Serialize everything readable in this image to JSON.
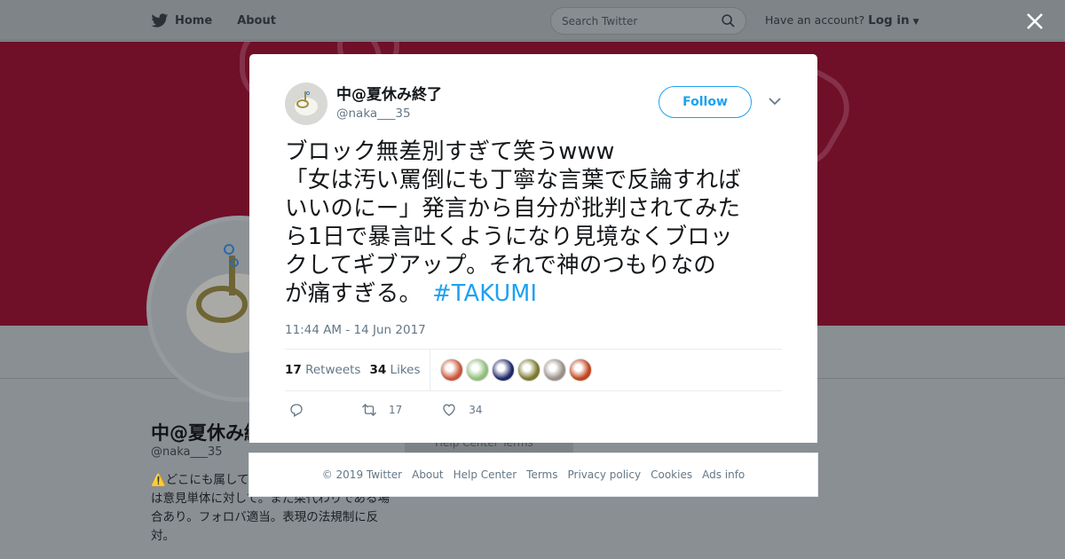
{
  "topbar": {
    "home_label": "Home",
    "about_label": "About",
    "search_placeholder": "Search Twitter",
    "have_account": "Have an account?",
    "login_label": "Log in"
  },
  "profile": {
    "name": "中@夏休み終了",
    "handle": "@naka___35",
    "bio": "⚠️どこにも属して… 基本めんどい。 いいねは意見単体に対して。また栞代わりである場合あり。フォロバ適当。表現の法規制に反対。",
    "footer_peek": "Help Center   Terms"
  },
  "tweet": {
    "author_name": "中@夏休み終了",
    "author_handle": "@naka___35",
    "follow_label": "Follow",
    "lines": [
      "ブロック無差別すぎて笑うwww",
      "「女は汚い罵倒にも丁寧な言葉で反論すれば",
      "いいのにー」発言から自分が批判されてみた",
      "ら1日で暴言吐くようになり見境なくブロッ",
      "クしてギブアップ。それで神のつもりなの",
      "が痛すぎる。"
    ],
    "hashtag": "#TAKUMI",
    "timestamp": "11:44 AM - 14 Jun 2017",
    "retweets_count": "17",
    "retweets_label": "Retweets",
    "likes_count": "34",
    "likes_label": "Likes",
    "action_retweet_count": "17",
    "action_like_count": "34",
    "likers": [
      {
        "color": "#c9563a"
      },
      {
        "color": "#8fbf7a"
      },
      {
        "color": "#1f2a6b"
      },
      {
        "color": "#7a7a2e"
      },
      {
        "color": "#9a8f88"
      },
      {
        "color": "#c1441d"
      }
    ]
  },
  "footer": {
    "links": [
      "© 2019 Twitter",
      "About",
      "Help Center",
      "Terms",
      "Privacy policy",
      "Cookies",
      "Ads info"
    ]
  },
  "colors": {
    "accent": "#1da1f2",
    "banner": "#6f0f28"
  }
}
